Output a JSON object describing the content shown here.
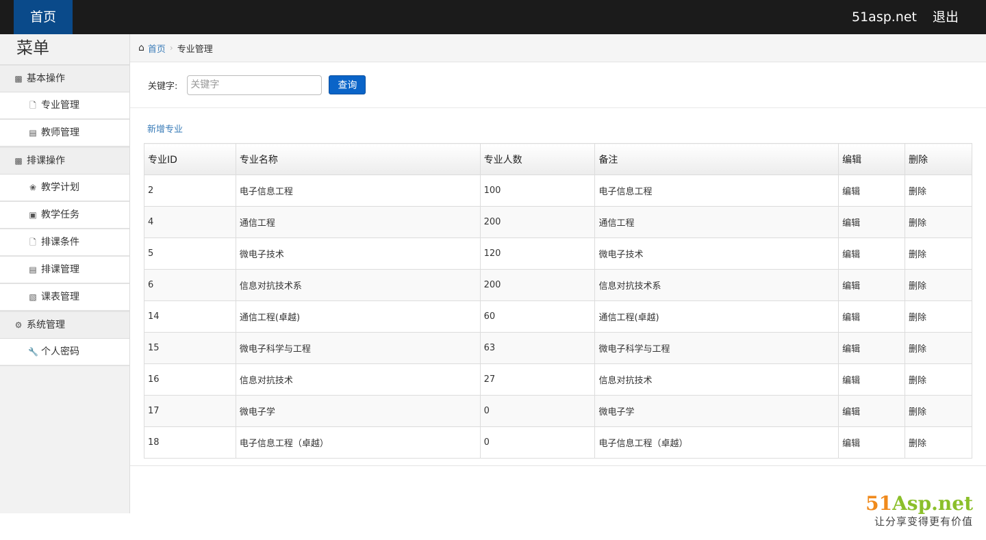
{
  "topbar": {
    "home": "首页",
    "site": "51asp.net",
    "logout": "退出"
  },
  "sidebar": {
    "title": "菜单",
    "groups": [
      {
        "label": "基本操作",
        "icon": "bold-b-icon",
        "items": [
          {
            "label": "专业管理",
            "icon": "file-icon"
          },
          {
            "label": "教师管理",
            "icon": "list-icon"
          }
        ]
      },
      {
        "label": "排课操作",
        "icon": "bold-b-icon",
        "items": [
          {
            "label": "教学计划",
            "icon": "leaf-icon"
          },
          {
            "label": "教学任务",
            "icon": "picture-icon"
          },
          {
            "label": "排课条件",
            "icon": "file-icon"
          },
          {
            "label": "排课管理",
            "icon": "list-icon"
          },
          {
            "label": "课表管理",
            "icon": "books-icon"
          }
        ]
      },
      {
        "label": "系统管理",
        "icon": "gear-icon",
        "items": [
          {
            "label": "个人密码",
            "icon": "wrench-icon"
          }
        ]
      }
    ]
  },
  "breadcrumb": {
    "home": "首页",
    "current": "专业管理"
  },
  "search": {
    "label": "关键字:",
    "placeholder": "关键字",
    "button": "查询"
  },
  "add_link": "新增专业",
  "table": {
    "headers": [
      "专业ID",
      "专业名称",
      "专业人数",
      "备注",
      "编辑",
      "删除"
    ],
    "rows": [
      {
        "id": "2",
        "name": "电子信息工程",
        "count": "100",
        "note": "电子信息工程",
        "edit": "编辑",
        "del": "删除"
      },
      {
        "id": "4",
        "name": "通信工程",
        "count": "200",
        "note": "通信工程",
        "edit": "编辑",
        "del": "删除"
      },
      {
        "id": "5",
        "name": "微电子技术",
        "count": "120",
        "note": "微电子技术",
        "edit": "编辑",
        "del": "删除"
      },
      {
        "id": "6",
        "name": "信息对抗技术系",
        "count": "200",
        "note": "信息对抗技术系",
        "edit": "编辑",
        "del": "删除"
      },
      {
        "id": "14",
        "name": "通信工程(卓越)",
        "count": "60",
        "note": "通信工程(卓越)",
        "edit": "编辑",
        "del": "删除"
      },
      {
        "id": "15",
        "name": "微电子科学与工程",
        "count": "63",
        "note": "微电子科学与工程",
        "edit": "编辑",
        "del": "删除"
      },
      {
        "id": "16",
        "name": "信息对抗技术",
        "count": "27",
        "note": "信息对抗技术",
        "edit": "编辑",
        "del": "删除"
      },
      {
        "id": "17",
        "name": "微电子学",
        "count": "0",
        "note": "微电子学",
        "edit": "编辑",
        "del": "删除"
      },
      {
        "id": "18",
        "name": "电子信息工程（卓越）",
        "count": "0",
        "note": "电子信息工程（卓越）",
        "edit": "编辑",
        "del": "删除"
      }
    ]
  },
  "watermark": {
    "logo_num": "51",
    "logo_txt": "Asp.net",
    "tagline": "让分享变得更有价值"
  }
}
